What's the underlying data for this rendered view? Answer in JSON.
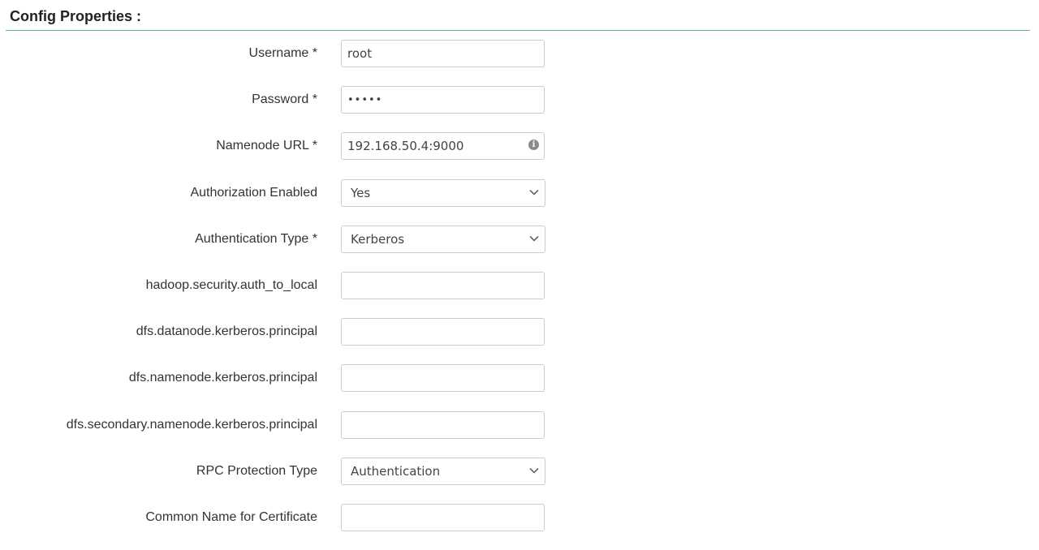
{
  "section": {
    "title": "Config Properties :"
  },
  "form": {
    "username": {
      "label": "Username *",
      "value": "root"
    },
    "password": {
      "label": "Password *",
      "value": "•••••"
    },
    "namenode_url": {
      "label": "Namenode URL *",
      "value": "192.168.50.4:9000",
      "icon": "info-icon"
    },
    "authorization_enabled": {
      "label": "Authorization Enabled",
      "selected": "Yes"
    },
    "authentication_type": {
      "label": "Authentication Type *",
      "selected": "Kerberos"
    },
    "auth_to_local": {
      "label": "hadoop.security.auth_to_local",
      "value": ""
    },
    "datanode_principal": {
      "label": "dfs.datanode.kerberos.principal",
      "value": ""
    },
    "namenode_principal": {
      "label": "dfs.namenode.kerberos.principal",
      "value": ""
    },
    "secondary_namenode_principal": {
      "label": "dfs.secondary.namenode.kerberos.principal",
      "value": ""
    },
    "rpc_protection_type": {
      "label": "RPC Protection Type",
      "selected": "Authentication"
    },
    "common_name": {
      "label": "Common Name for Certificate",
      "value": ""
    }
  },
  "colors": {
    "divider": "#5fb9b0",
    "field_border": "#cccccc",
    "label_text": "#333333"
  }
}
